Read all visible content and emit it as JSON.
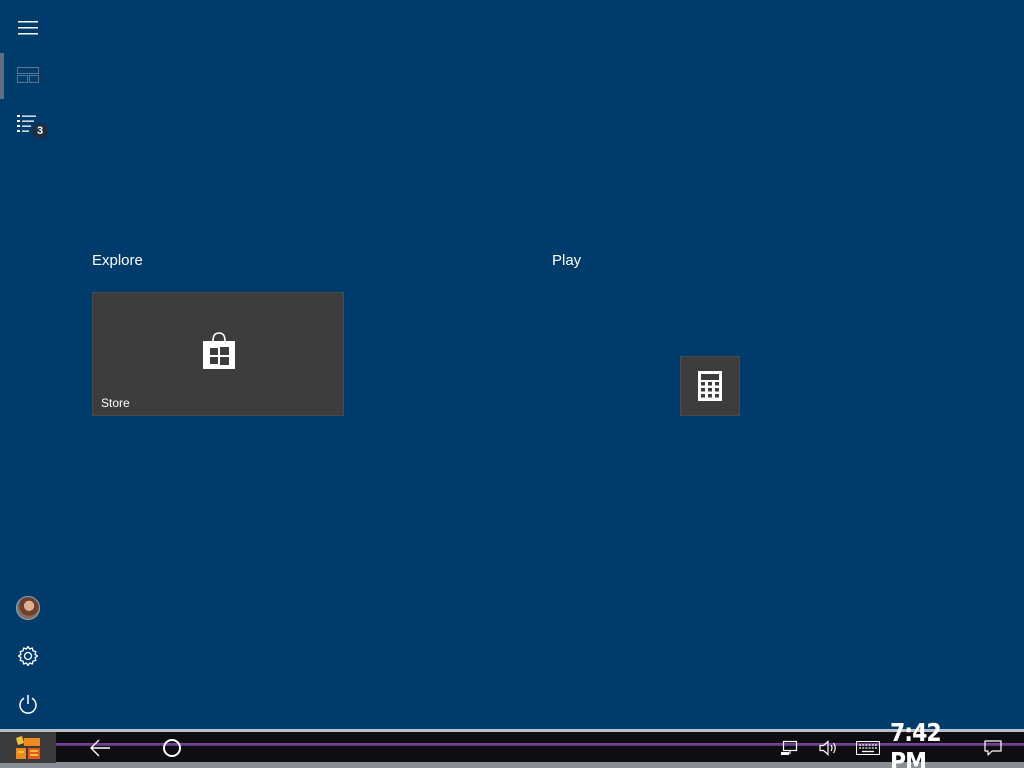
{
  "rail": {
    "items": [
      {
        "name": "hamburger-menu-icon"
      },
      {
        "name": "all-tiles-icon"
      },
      {
        "name": "all-apps-list-icon",
        "badge": "3"
      }
    ],
    "bottom": [
      {
        "name": "user-avatar"
      },
      {
        "name": "settings-gear-icon"
      },
      {
        "name": "power-icon"
      }
    ]
  },
  "groups": [
    {
      "title": "Explore",
      "tiles": [
        {
          "label": "Store",
          "icon": "store-bag-icon",
          "color": "#3d3d3d"
        }
      ]
    },
    {
      "title": "Play",
      "tiles": [
        {
          "label": "",
          "icon": "calculator-icon",
          "color": "#3d3d3d"
        }
      ]
    }
  ],
  "taskbar": {
    "start_icon": "custom-start-logo-icon",
    "back_icon": "back-arrow-icon",
    "search_icon": "cortana-circle-icon",
    "tray": [
      "network-icon",
      "volume-icon",
      "keyboard-icon"
    ],
    "clock": "7:42 PM",
    "action_center_icon": "action-center-icon"
  },
  "colors": {
    "desktop_bg": "#003c6b",
    "tile_bg": "#3d3d3d",
    "taskbar_accent": "#7d4a9a"
  }
}
